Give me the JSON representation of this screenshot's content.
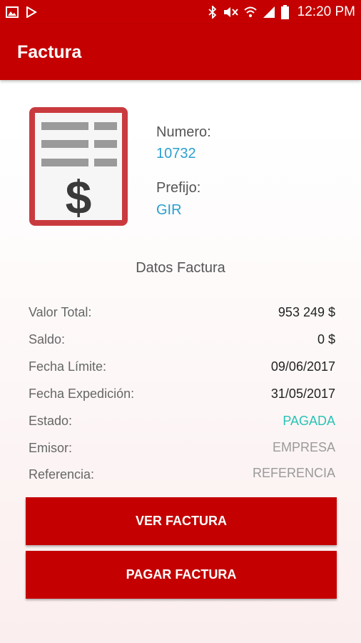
{
  "status_bar": {
    "time": "12:20 PM"
  },
  "app_bar": {
    "title": "Factura"
  },
  "invoice": {
    "numero_label": "Numero:",
    "numero_value": "10732",
    "prefijo_label": "Prefijo:",
    "prefijo_value": "GIR"
  },
  "section": {
    "title": "Datos Factura"
  },
  "details": [
    {
      "label": "Valor Total:",
      "value": "953 249 $"
    },
    {
      "label": "Saldo:",
      "value": "0 $"
    },
    {
      "label": "Fecha Límite:",
      "value": "09/06/2017"
    },
    {
      "label": "Fecha Expedición:",
      "value": "31/05/2017"
    },
    {
      "label": "Estado:",
      "value": "PAGADA"
    },
    {
      "label": "Emisor:",
      "value": "EMPRESA"
    },
    {
      "label": "Referencia:",
      "value": "REFERENCIA"
    }
  ],
  "buttons": {
    "view": "VER FACTURA",
    "pay": "PAGAR FACTURA"
  },
  "colors": {
    "primary": "#c40000",
    "accent": "#2a9fd0",
    "status_paid": "#29c3b4"
  }
}
